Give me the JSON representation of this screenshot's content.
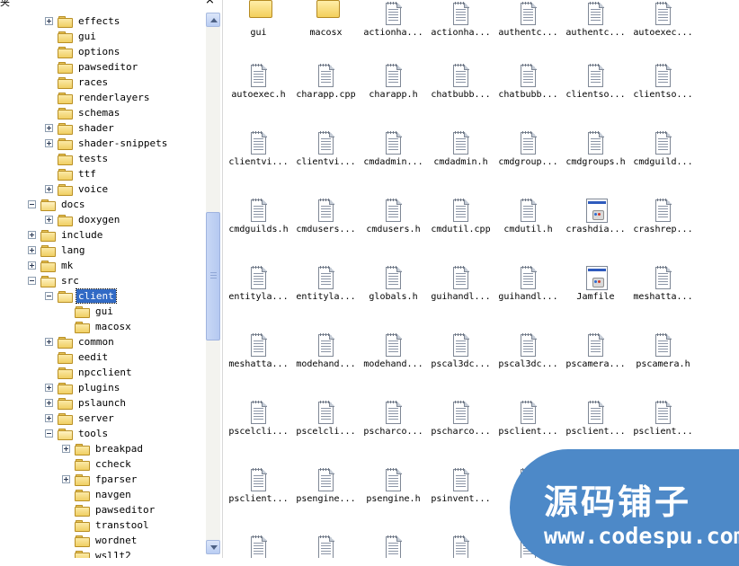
{
  "tree": {
    "header_title": "夹",
    "close_label": "×",
    "rows": [
      {
        "label": "effects",
        "level": 3,
        "expander": "plus",
        "open": false,
        "selected": false
      },
      {
        "label": "gui",
        "level": 3,
        "expander": "none",
        "open": false,
        "selected": false
      },
      {
        "label": "options",
        "level": 3,
        "expander": "none",
        "open": false,
        "selected": false
      },
      {
        "label": "pawseditor",
        "level": 3,
        "expander": "none",
        "open": false,
        "selected": false
      },
      {
        "label": "races",
        "level": 3,
        "expander": "none",
        "open": false,
        "selected": false
      },
      {
        "label": "renderlayers",
        "level": 3,
        "expander": "none",
        "open": false,
        "selected": false
      },
      {
        "label": "schemas",
        "level": 3,
        "expander": "none",
        "open": false,
        "selected": false
      },
      {
        "label": "shader",
        "level": 3,
        "expander": "plus",
        "open": false,
        "selected": false
      },
      {
        "label": "shader-snippets",
        "level": 3,
        "expander": "plus",
        "open": false,
        "selected": false
      },
      {
        "label": "tests",
        "level": 3,
        "expander": "none",
        "open": false,
        "selected": false
      },
      {
        "label": "ttf",
        "level": 3,
        "expander": "none",
        "open": false,
        "selected": false
      },
      {
        "label": "voice",
        "level": 3,
        "expander": "plus",
        "open": false,
        "selected": false
      },
      {
        "label": "docs",
        "level": 2,
        "expander": "minus",
        "open": true,
        "selected": false
      },
      {
        "label": "doxygen",
        "level": 3,
        "expander": "plus",
        "open": false,
        "selected": false
      },
      {
        "label": "include",
        "level": 2,
        "expander": "plus",
        "open": false,
        "selected": false
      },
      {
        "label": "lang",
        "level": 2,
        "expander": "plus",
        "open": false,
        "selected": false
      },
      {
        "label": "mk",
        "level": 2,
        "expander": "plus",
        "open": false,
        "selected": false
      },
      {
        "label": "src",
        "level": 2,
        "expander": "minus",
        "open": true,
        "selected": false
      },
      {
        "label": "client",
        "level": 3,
        "expander": "minus",
        "open": true,
        "selected": true
      },
      {
        "label": "gui",
        "level": 4,
        "expander": "none",
        "open": false,
        "selected": false
      },
      {
        "label": "macosx",
        "level": 4,
        "expander": "none",
        "open": false,
        "selected": false
      },
      {
        "label": "common",
        "level": 3,
        "expander": "plus",
        "open": false,
        "selected": false
      },
      {
        "label": "eedit",
        "level": 3,
        "expander": "none",
        "open": false,
        "selected": false
      },
      {
        "label": "npcclient",
        "level": 3,
        "expander": "none",
        "open": false,
        "selected": false
      },
      {
        "label": "plugins",
        "level": 3,
        "expander": "plus",
        "open": false,
        "selected": false
      },
      {
        "label": "pslaunch",
        "level": 3,
        "expander": "plus",
        "open": false,
        "selected": false
      },
      {
        "label": "server",
        "level": 3,
        "expander": "plus",
        "open": false,
        "selected": false
      },
      {
        "label": "tools",
        "level": 3,
        "expander": "minus",
        "open": true,
        "selected": false
      },
      {
        "label": "breakpad",
        "level": 4,
        "expander": "plus",
        "open": false,
        "selected": false
      },
      {
        "label": "ccheck",
        "level": 4,
        "expander": "none",
        "open": false,
        "selected": false
      },
      {
        "label": "fparser",
        "level": 4,
        "expander": "plus",
        "open": false,
        "selected": false
      },
      {
        "label": "navgen",
        "level": 4,
        "expander": "none",
        "open": false,
        "selected": false
      },
      {
        "label": "pawseditor",
        "level": 4,
        "expander": "none",
        "open": false,
        "selected": false
      },
      {
        "label": "transtool",
        "level": 4,
        "expander": "none",
        "open": false,
        "selected": false
      },
      {
        "label": "wordnet",
        "level": 4,
        "expander": "none",
        "open": false,
        "selected": false
      },
      {
        "label": "wsl1t2",
        "level": 4,
        "expander": "none",
        "open": false,
        "selected": false
      }
    ]
  },
  "files": [
    {
      "name": "gui",
      "icon": "folder-icon",
      "kind": "folder"
    },
    {
      "name": "macosx",
      "icon": "folder-icon",
      "kind": "folder"
    },
    {
      "name": "actionha...",
      "icon": "source-file-icon",
      "kind": "doc"
    },
    {
      "name": "actionha...",
      "icon": "source-file-icon",
      "kind": "doc"
    },
    {
      "name": "authentc...",
      "icon": "source-file-icon",
      "kind": "doc"
    },
    {
      "name": "authentc...",
      "icon": "source-file-icon",
      "kind": "doc"
    },
    {
      "name": "autoexec...",
      "icon": "source-file-icon",
      "kind": "doc"
    },
    {
      "name": "autoexec.h",
      "icon": "source-file-icon",
      "kind": "doc"
    },
    {
      "name": "charapp.cpp",
      "icon": "source-file-icon",
      "kind": "doc"
    },
    {
      "name": "charapp.h",
      "icon": "source-file-icon",
      "kind": "doc"
    },
    {
      "name": "chatbubb...",
      "icon": "source-file-icon",
      "kind": "doc"
    },
    {
      "name": "chatbubb...",
      "icon": "source-file-icon",
      "kind": "doc"
    },
    {
      "name": "clientso...",
      "icon": "source-file-icon",
      "kind": "doc"
    },
    {
      "name": "clientso...",
      "icon": "source-file-icon",
      "kind": "doc"
    },
    {
      "name": "clientvi...",
      "icon": "source-file-icon",
      "kind": "doc"
    },
    {
      "name": "clientvi...",
      "icon": "source-file-icon",
      "kind": "doc"
    },
    {
      "name": "cmdadmin...",
      "icon": "source-file-icon",
      "kind": "doc"
    },
    {
      "name": "cmdadmin.h",
      "icon": "source-file-icon",
      "kind": "doc"
    },
    {
      "name": "cmdgroup...",
      "icon": "source-file-icon",
      "kind": "doc"
    },
    {
      "name": "cmdgroups.h",
      "icon": "source-file-icon",
      "kind": "doc"
    },
    {
      "name": "cmdguild...",
      "icon": "source-file-icon",
      "kind": "doc"
    },
    {
      "name": "cmdguilds.h",
      "icon": "source-file-icon",
      "kind": "doc"
    },
    {
      "name": "cmdusers...",
      "icon": "source-file-icon",
      "kind": "doc"
    },
    {
      "name": "cmdusers.h",
      "icon": "source-file-icon",
      "kind": "doc"
    },
    {
      "name": "cmdutil.cpp",
      "icon": "source-file-icon",
      "kind": "doc"
    },
    {
      "name": "cmdutil.h",
      "icon": "source-file-icon",
      "kind": "doc"
    },
    {
      "name": "crashdia...",
      "icon": "generic-file-icon",
      "kind": "app"
    },
    {
      "name": "crashrep...",
      "icon": "source-file-icon",
      "kind": "doc"
    },
    {
      "name": "entityla...",
      "icon": "source-file-icon",
      "kind": "doc"
    },
    {
      "name": "entityla...",
      "icon": "source-file-icon",
      "kind": "doc"
    },
    {
      "name": "globals.h",
      "icon": "source-file-icon",
      "kind": "doc"
    },
    {
      "name": "guihandl...",
      "icon": "source-file-icon",
      "kind": "doc"
    },
    {
      "name": "guihandl...",
      "icon": "source-file-icon",
      "kind": "doc"
    },
    {
      "name": "Jamfile",
      "icon": "generic-file-icon",
      "kind": "app"
    },
    {
      "name": "meshatta...",
      "icon": "source-file-icon",
      "kind": "doc"
    },
    {
      "name": "meshatta...",
      "icon": "source-file-icon",
      "kind": "doc"
    },
    {
      "name": "modehand...",
      "icon": "source-file-icon",
      "kind": "doc"
    },
    {
      "name": "modehand...",
      "icon": "source-file-icon",
      "kind": "doc"
    },
    {
      "name": "pscal3dc...",
      "icon": "source-file-icon",
      "kind": "doc"
    },
    {
      "name": "pscal3dc...",
      "icon": "source-file-icon",
      "kind": "doc"
    },
    {
      "name": "pscamera...",
      "icon": "source-file-icon",
      "kind": "doc"
    },
    {
      "name": "pscamera.h",
      "icon": "source-file-icon",
      "kind": "doc"
    },
    {
      "name": "pscelcli...",
      "icon": "source-file-icon",
      "kind": "doc"
    },
    {
      "name": "pscelcli...",
      "icon": "source-file-icon",
      "kind": "doc"
    },
    {
      "name": "pscharco...",
      "icon": "source-file-icon",
      "kind": "doc"
    },
    {
      "name": "pscharco...",
      "icon": "source-file-icon",
      "kind": "doc"
    },
    {
      "name": "psclient...",
      "icon": "source-file-icon",
      "kind": "doc"
    },
    {
      "name": "psclient...",
      "icon": "source-file-icon",
      "kind": "doc"
    },
    {
      "name": "psclient...",
      "icon": "source-file-icon",
      "kind": "doc"
    },
    {
      "name": "psclient...",
      "icon": "source-file-icon",
      "kind": "doc"
    },
    {
      "name": "psengine...",
      "icon": "source-file-icon",
      "kind": "doc"
    },
    {
      "name": "psengine.h",
      "icon": "source-file-icon",
      "kind": "doc"
    },
    {
      "name": "psinvent...",
      "icon": "source-file-icon",
      "kind": "doc"
    },
    {
      "name": "psi",
      "icon": "source-file-icon",
      "kind": "doc"
    },
    {
      "name": "",
      "icon": "source-file-icon",
      "kind": "doc"
    },
    {
      "name": "",
      "icon": "source-file-icon",
      "kind": "doc"
    },
    {
      "name": "",
      "icon": "source-file-icon",
      "kind": "doc"
    },
    {
      "name": "",
      "icon": "source-file-icon",
      "kind": "doc"
    },
    {
      "name": "",
      "icon": "source-file-icon",
      "kind": "doc"
    },
    {
      "name": "",
      "icon": "source-file-icon",
      "kind": "doc"
    },
    {
      "name": "",
      "icon": "source-file-icon",
      "kind": "doc"
    }
  ],
  "watermark": {
    "title": "源码铺子",
    "url": "www.codespu.com"
  },
  "colors": {
    "selection": "#316ac5",
    "watermark_bg": "#4d89c8",
    "folder_yellow": "#f3cf5c"
  }
}
